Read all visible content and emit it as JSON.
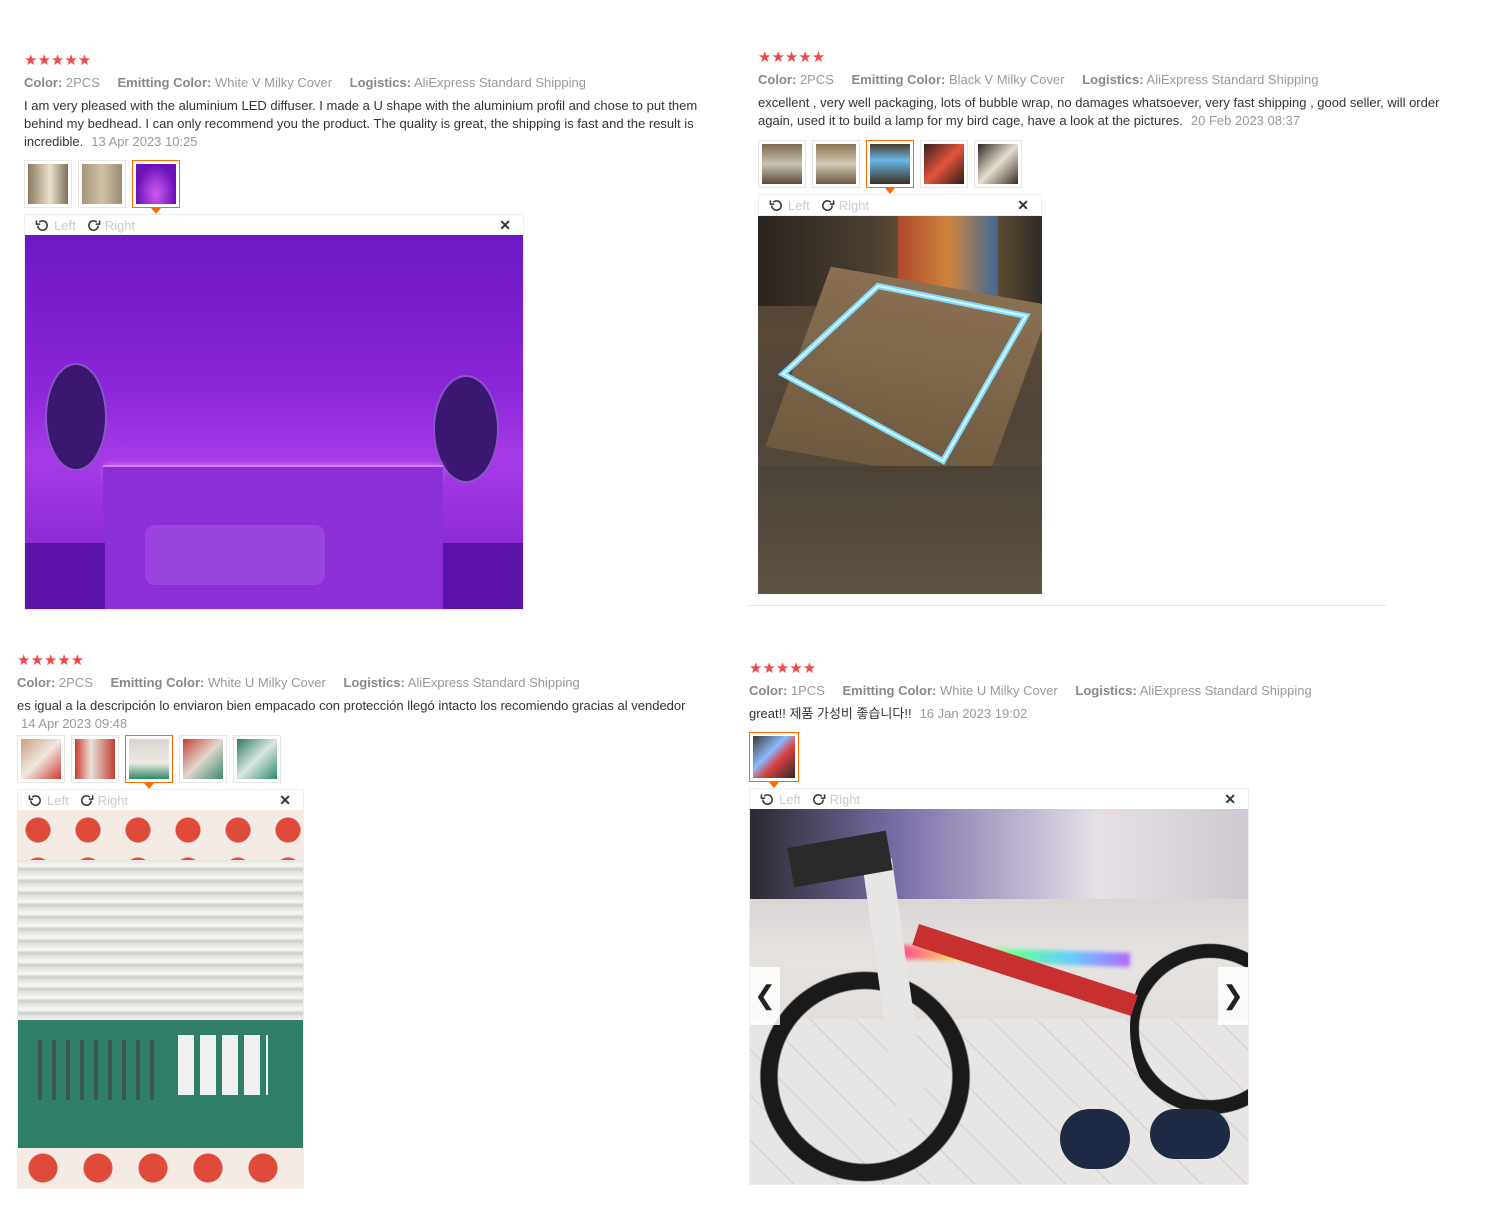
{
  "labels": {
    "color": "Color:",
    "emitting": "Emitting Color:",
    "logistics": "Logistics:",
    "left": "Left",
    "right": "Right"
  },
  "stars": "★★★★★",
  "reviews": [
    {
      "color": "2PCS",
      "emitting": "White V Milky Cover",
      "logistics": "AliExpress Standard Shipping",
      "text": "I am very pleased with the aluminium LED diffuser. I made a U shape with the aluminium profil and chose to put them behind my bedhead. I can only recommend you the product. The quality is great, the shipping is fast and the result is incredible.",
      "date": "13 Apr 2023 10:25"
    },
    {
      "color": "2PCS",
      "emitting": "Black V Milky Cover",
      "logistics": "AliExpress Standard Shipping",
      "text": "excellent , very well packaging, lots of bubble wrap, no damages whatsoever, very fast shipping , good seller, will order again, used it to build a lamp for my bird cage, have a look at the pictures.",
      "date": "20 Feb 2023 08:37"
    },
    {
      "color": "2PCS",
      "emitting": "White U Milky Cover",
      "logistics": "AliExpress Standard Shipping",
      "text": "es igual a la descripción lo enviaron bien empacado con protección llegó intacto los recomiendo gracias al vendedor",
      "date": "14 Apr 2023 09:48"
    },
    {
      "color": "1PCS",
      "emitting": "White U Milky Cover",
      "logistics": "AliExpress Standard Shipping",
      "text": "great!! 제품 가성비 좋습니다!!",
      "date": "16 Jan 2023 19:02"
    }
  ],
  "colors": {
    "star": "#f04848",
    "active_thumb": "#ff6a00"
  }
}
